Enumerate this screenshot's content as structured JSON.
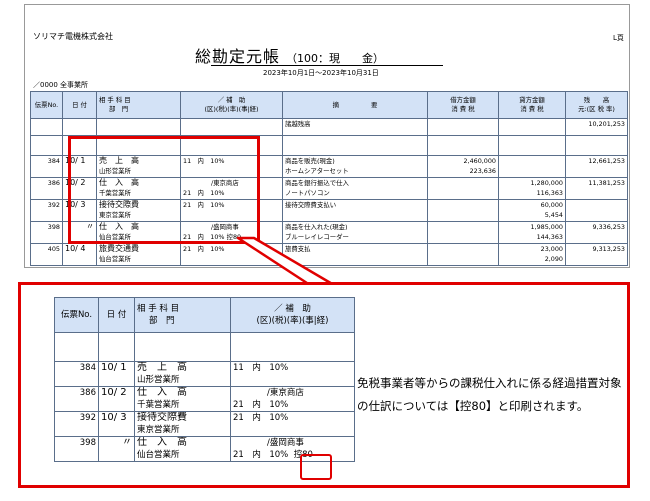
{
  "company": "ソリマチ電機株式会社",
  "corner_mark": "L頁",
  "title": "総勘定元帳",
  "account": "（100：現　　金）",
  "period": "2023年10月1日～2023年10月31日",
  "department": "／0000 全事業所",
  "headers": {
    "voucher": "伝票No.",
    "date": "日 付",
    "account_line1": "相 手 科 目",
    "account_line2": "部　門",
    "aux_line1": "／ 補　助",
    "aux_line2": "(区)(税)(率)(事|経)",
    "summary": "摘　　　　　要",
    "debit_line1": "借方金額",
    "debit_line2": "消 費 税",
    "credit_line1": "貸方金額",
    "credit_line2": "消 費 税",
    "balance_line1": "残　　高",
    "balance_line2": "元:(区 税 率)"
  },
  "opening": {
    "summary": "諸越残高",
    "balance": "10,201,253"
  },
  "rows": [
    {
      "no": "384",
      "date": "10/ 1",
      "account": "売　上　高",
      "aux": "",
      "dept": "山形営業所",
      "tax": "11　内　10%",
      "summary1": "商品を販売(現金)",
      "summary2": "ホームシアターセット",
      "debit": "2,460,000",
      "debit_tax": "223,636",
      "credit": "",
      "credit_tax": "",
      "balance": "12,661,253"
    },
    {
      "no": "386",
      "date": "10/ 2",
      "account": "仕　入　高",
      "aux": "/東京商店",
      "dept": "千葉営業所",
      "tax": "21　内　10%",
      "summary1": "商品を銀行振込で仕入",
      "summary2": "ノートパソコン",
      "debit": "",
      "debit_tax": "",
      "credit": "1,280,000",
      "credit_tax": "116,363",
      "balance": "11,381,253"
    },
    {
      "no": "392",
      "date": "10/ 3",
      "account": "接待交際費",
      "aux": "",
      "dept": "東京営業所",
      "tax": "21　内　10%",
      "summary1": "接待交際費支払い",
      "summary2": "",
      "debit": "",
      "debit_tax": "",
      "credit": "60,000",
      "credit_tax": "5,454",
      "balance": ""
    },
    {
      "no": "398",
      "date": "〃",
      "account": "仕　入　高",
      "aux": "/盛岡商事",
      "dept": "仙台営業所",
      "tax": "21　内　10%",
      "ctrl": "控80",
      "summary1": "商品を仕入れた(現金)",
      "summary2": "ブルーレイレコーダー",
      "debit": "",
      "debit_tax": "",
      "credit": "1,985,000",
      "credit_tax": "144,363",
      "balance": "9,336,253"
    },
    {
      "no": "405",
      "date": "10/ 4",
      "account": "旅費交通費",
      "aux": "",
      "dept": "仙台営業所",
      "tax": "21　内　10%",
      "summary1": "旅費支払",
      "summary2": "",
      "debit": "",
      "debit_tax": "",
      "credit": "23,000",
      "credit_tax": "2,090",
      "balance": "9,313,253"
    }
  ],
  "note": "免税事業者等からの課税仕入れに係る経過措置対象の仕訳については【控80】と印刷されます。"
}
